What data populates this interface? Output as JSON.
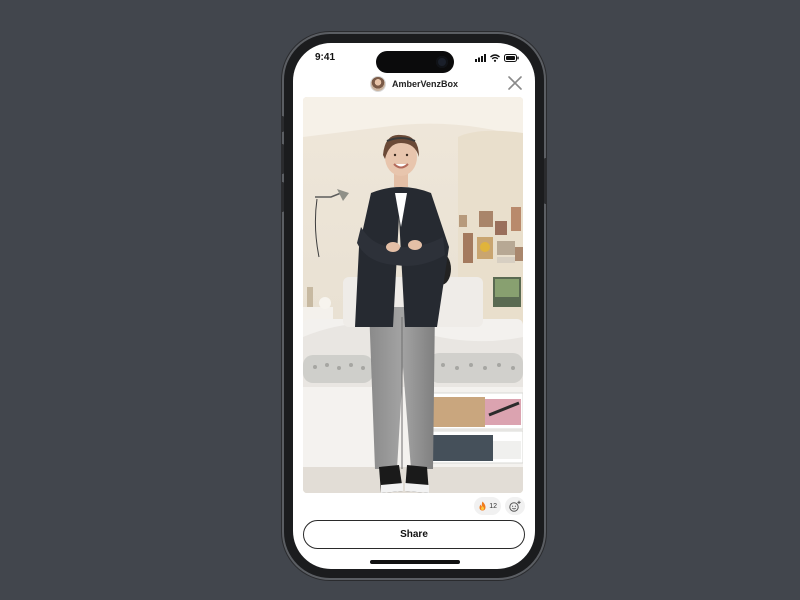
{
  "status_bar": {
    "time": "9:41"
  },
  "header": {
    "username": "AmberVenzBox"
  },
  "reactions": {
    "fire_count": "12"
  },
  "actions": {
    "share_label": "Share"
  },
  "colors": {
    "background": "#42464d",
    "screen": "#ffffff",
    "accent_dark": "#111111"
  }
}
